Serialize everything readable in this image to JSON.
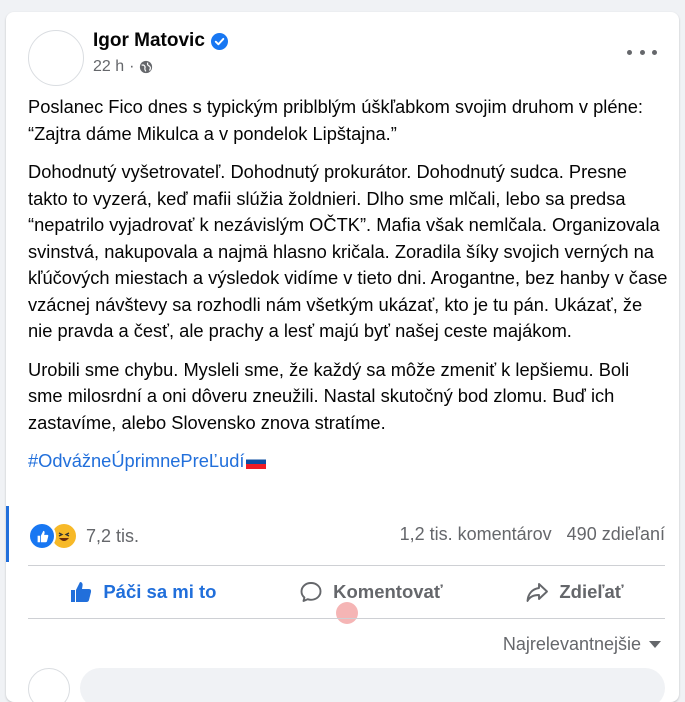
{
  "post": {
    "author": "Igor Matovic",
    "time": "22 h",
    "dot": "·",
    "paragraphs": [
      "Poslanec Fico dnes s typickým priblblým úškľabkom svojim druhom v pléne: “Zajtra dáme Mikulca a v pondelok Lipštajna.”",
      "Dohodnutý vyšetrovateľ. Dohodnutý prokurátor. Dohodnutý sudca. Presne takto to vyzerá, keď mafii slúžia žoldnieri. Dlho sme mlčali, lebo sa predsa “nepatrilo vyjadrovať k nezávislým OČTK”. Mafia však nemlčala. Organizovala svinstvá, nakupovala a najmä hlasno kričala. Zoradila šíky svojich verných na kľúčových miestach a výsledok vidíme v tieto dni. Arogantne, bez hanby v čase vzácnej návštevy sa rozhodli nám všetkým ukázať, kto je tu pán. Ukázať, že nie pravda a česť, ale prachy a lesť majú byť našej ceste majákom.",
      "Urobili sme chybu. Mysleli sme, že každý sa môže zmeniť k lepšiemu. Boli sme milosrdní a oni dôveru zneužili. Nastal skutočný bod zlomu. Buď ich zastavíme, alebo Slovensko znova stratíme."
    ],
    "hashtag": "#OdvážneÚprimnePreĽudí"
  },
  "stats": {
    "reactions": "7,2 tis.",
    "comments": "1,2 tis. komentárov",
    "shares": "490 zdieľaní"
  },
  "actions": {
    "like": "Páči sa mi to",
    "comment": "Komentovať",
    "share": "Zdieľať"
  },
  "sort": {
    "label": "Najrelevantnejšie"
  },
  "colors": {
    "accent": "#216fdb",
    "secondary_text": "#65676b",
    "background": "#f0f2f5"
  },
  "icons": [
    "verified-badge-icon",
    "globe-icon",
    "more-options-icon",
    "like-reaction-icon",
    "haha-reaction-icon",
    "thumbs-up-icon",
    "comment-icon",
    "share-icon",
    "chevron-down-icon"
  ]
}
